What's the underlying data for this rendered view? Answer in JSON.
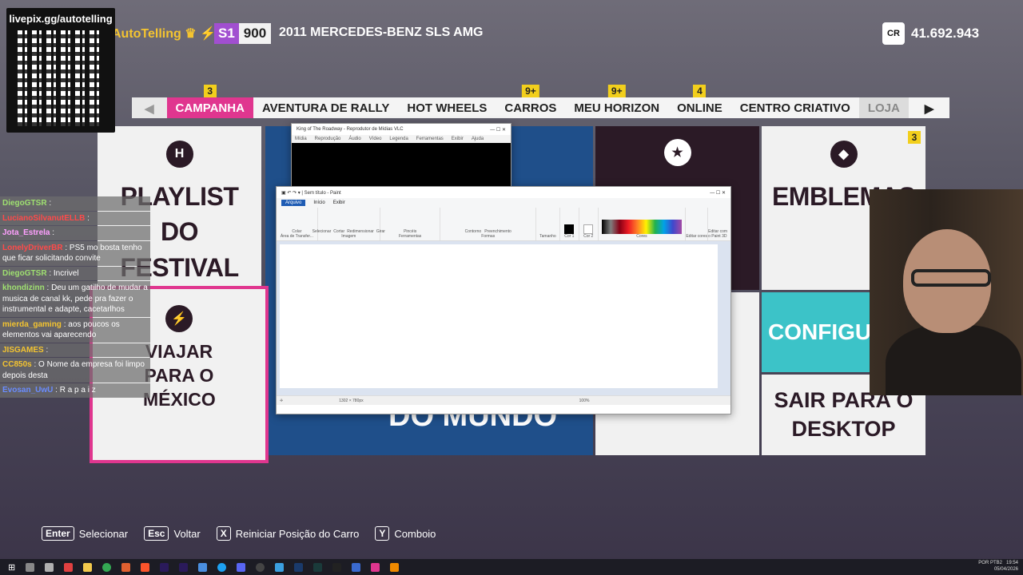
{
  "overlay": {
    "qr_title": "livepix.gg/autotelling"
  },
  "hud": {
    "gamertag": "AutoTelling",
    "pi_class": "S1",
    "pi_value": "900",
    "car": "2011 MERCEDES-BENZ SLS AMG",
    "cr_label": "CR",
    "credits": "41.692.943"
  },
  "tabs": [
    {
      "label": "CAMPANHA",
      "badge": "3"
    },
    {
      "label": "AVENTURA DE RALLY",
      "badge": ""
    },
    {
      "label": "HOT WHEELS",
      "badge": ""
    },
    {
      "label": "CARROS",
      "badge": "9+"
    },
    {
      "label": "MEU HORIZON",
      "badge": "9+"
    },
    {
      "label": "ONLINE",
      "badge": "4"
    },
    {
      "label": "CENTRO CRIATIVO",
      "badge": ""
    },
    {
      "label": "LOJA",
      "badge": ""
    }
  ],
  "tiles": {
    "playlist": "PLAYLIST DO FESTIVAL",
    "viajar": "VIAJAR PARA O MÉXICO",
    "emblemas": "EMBLEMAS",
    "emblemas_badge": "3",
    "configuracoes": "CONFIGURA",
    "sair": "SAIR PARA O DESKTOP",
    "mundo": "DO MUNDO"
  },
  "chat": [
    {
      "user": "DiegoGTSR",
      "msg": "",
      "color": "#9fe070"
    },
    {
      "user": "LucianoSilvanutELLB",
      "msg": "",
      "color": "#ff4a4a"
    },
    {
      "user": "Jota_Estrela",
      "msg": "",
      "color": "#ffa0ff"
    },
    {
      "user": "LonelyDriverBR",
      "msg": "PS5 mo bosta tenho que ficar solicitando convite",
      "color": "#ff4a4a"
    },
    {
      "user": "DiegoGTSR",
      "msg": "Incrivel",
      "color": "#9fe070"
    },
    {
      "user": "khondizinn",
      "msg": "Deu um gatilho de mudar a musica de canal kk, pede pra fazer o instrumental e adapte, cacetarlhos",
      "color": "#9fe070"
    },
    {
      "user": "mierda_gaming",
      "msg": "aos poucos os elementos vai aparecendo",
      "color": "#f4c430"
    },
    {
      "user": "JISGAMES",
      "msg": "",
      "color": "#f4c430"
    },
    {
      "user": "CC850s",
      "msg": "O Nome da empresa foi limpo depois desta",
      "color": "#f4c430"
    },
    {
      "user": "Evosan_UwU",
      "msg": "R a p a i z",
      "color": "#6a8cff"
    }
  ],
  "vlc": {
    "title": "King of The Roadway - Reprodutor de Mídias VLC",
    "menus": [
      "Mídia",
      "Reprodução",
      "Áudio",
      "Vídeo",
      "Legenda",
      "Ferramentas",
      "Exibir",
      "Ajuda"
    ]
  },
  "paint": {
    "title": "Sem título - Paint",
    "tabs": [
      "Arquivo",
      "Início",
      "Exibir"
    ],
    "groups": [
      "Área de Transfer...",
      "Imagem",
      "Ferramentas",
      "Formas",
      "Tamanho",
      "Cor 1",
      "Cor 2",
      "Cores",
      "Editar cores",
      "Editar com o Paint 3D"
    ],
    "tools": [
      "Colar",
      "Selecionar",
      "Cortar",
      "Redimensionar",
      "Girar",
      "Pincéis",
      "Contorno",
      "Preenchimento"
    ],
    "dimensions": "1302 × 780px",
    "zoom": "100%"
  },
  "footer": [
    {
      "key": "Enter",
      "label": "Selecionar"
    },
    {
      "key": "Esc",
      "label": "Voltar"
    },
    {
      "key": "X",
      "label": "Reiniciar Posição do Carro"
    },
    {
      "key": "Y",
      "label": "Comboio"
    }
  ],
  "taskbar": {
    "lang": "POR PTB2",
    "time": "19:54",
    "date": "05/04/2026"
  },
  "colors": {
    "accent": "#e0368f",
    "badge": "#f2cf1c",
    "pi": "#a14fd0",
    "teal": "#3cc3c8",
    "dark_tile": "#2b1a26"
  }
}
